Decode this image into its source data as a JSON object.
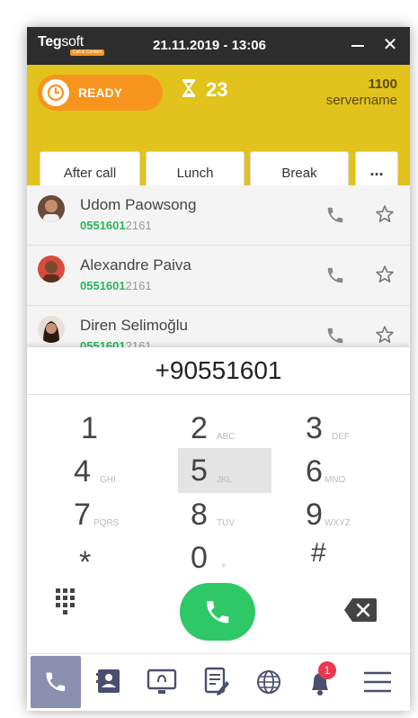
{
  "titlebar": {
    "logo_main": "Teg",
    "logo_soft": "soft",
    "logo_tag": "Call & Contact",
    "datetime": "21.11.2019 - 13:06"
  },
  "header": {
    "status": "READY",
    "timer": "23",
    "extension": "1100",
    "server": "servername",
    "buttons": [
      "After call",
      "Lunch",
      "Break",
      "..."
    ],
    "colors": {
      "header_bg": "#e2c21c",
      "status_bg": "#f7941d"
    }
  },
  "contacts": [
    {
      "name": "Udom Paowsong",
      "number_match": "0551601",
      "number_rest": "2161"
    },
    {
      "name": "Alexandre Paiva",
      "number_match": "0551601",
      "number_rest": "2161"
    },
    {
      "name": "Diren Selimoğlu",
      "number_match": "0551601",
      "number_rest": "2161"
    }
  ],
  "dialer": {
    "value": "+90551601",
    "keys": [
      {
        "d": "1",
        "l": ""
      },
      {
        "d": "2",
        "l": "ABC"
      },
      {
        "d": "3",
        "l": "DEF"
      },
      {
        "d": "4",
        "l": "GHI"
      },
      {
        "d": "5",
        "l": "JKL"
      },
      {
        "d": "6",
        "l": "MNO"
      },
      {
        "d": "7",
        "l": "PQRS"
      },
      {
        "d": "8",
        "l": "TUV"
      },
      {
        "d": "9",
        "l": "WXYZ"
      },
      {
        "d": "*",
        "l": ""
      },
      {
        "d": "0",
        "l": "+"
      },
      {
        "d": "#",
        "l": ""
      }
    ],
    "call_color": "#2ec866"
  },
  "nav": {
    "notification_count": "1",
    "items": [
      "phone-icon",
      "contacts-icon",
      "monitor-icon",
      "notes-icon",
      "globe-icon",
      "bell-icon",
      "menu-icon"
    ]
  }
}
